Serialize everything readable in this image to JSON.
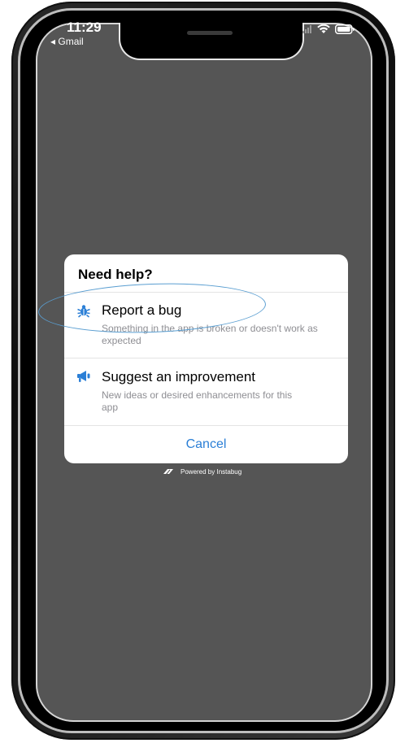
{
  "status_bar": {
    "time": "11:29",
    "back_label": "◂ Gmail"
  },
  "dialog": {
    "title": "Need help?",
    "options": [
      {
        "icon": "bug-icon",
        "title": "Report a bug",
        "description": "Something in the app is broken or doesn't work as expected"
      },
      {
        "icon": "megaphone-icon",
        "title": "Suggest an improvement",
        "description": "New ideas or desired enhancements for this app"
      }
    ],
    "cancel_label": "Cancel"
  },
  "footer": {
    "powered_by": "Powered by Instabug"
  },
  "colors": {
    "accent": "#2b7fd6",
    "overlay": "#555555",
    "annotation": "#5a9ed1"
  }
}
